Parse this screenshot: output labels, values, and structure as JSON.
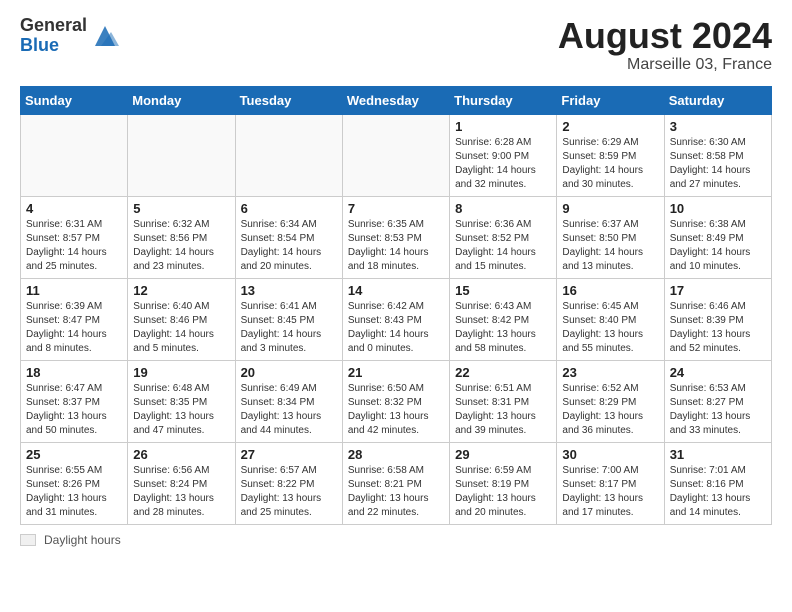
{
  "header": {
    "logo_general": "General",
    "logo_blue": "Blue",
    "month_year": "August 2024",
    "location": "Marseille 03, France"
  },
  "weekdays": [
    "Sunday",
    "Monday",
    "Tuesday",
    "Wednesday",
    "Thursday",
    "Friday",
    "Saturday"
  ],
  "weeks": [
    [
      {
        "day": "",
        "info": ""
      },
      {
        "day": "",
        "info": ""
      },
      {
        "day": "",
        "info": ""
      },
      {
        "day": "",
        "info": ""
      },
      {
        "day": "1",
        "info": "Sunrise: 6:28 AM\nSunset: 9:00 PM\nDaylight: 14 hours\nand 32 minutes."
      },
      {
        "day": "2",
        "info": "Sunrise: 6:29 AM\nSunset: 8:59 PM\nDaylight: 14 hours\nand 30 minutes."
      },
      {
        "day": "3",
        "info": "Sunrise: 6:30 AM\nSunset: 8:58 PM\nDaylight: 14 hours\nand 27 minutes."
      }
    ],
    [
      {
        "day": "4",
        "info": "Sunrise: 6:31 AM\nSunset: 8:57 PM\nDaylight: 14 hours\nand 25 minutes."
      },
      {
        "day": "5",
        "info": "Sunrise: 6:32 AM\nSunset: 8:56 PM\nDaylight: 14 hours\nand 23 minutes."
      },
      {
        "day": "6",
        "info": "Sunrise: 6:34 AM\nSunset: 8:54 PM\nDaylight: 14 hours\nand 20 minutes."
      },
      {
        "day": "7",
        "info": "Sunrise: 6:35 AM\nSunset: 8:53 PM\nDaylight: 14 hours\nand 18 minutes."
      },
      {
        "day": "8",
        "info": "Sunrise: 6:36 AM\nSunset: 8:52 PM\nDaylight: 14 hours\nand 15 minutes."
      },
      {
        "day": "9",
        "info": "Sunrise: 6:37 AM\nSunset: 8:50 PM\nDaylight: 14 hours\nand 13 minutes."
      },
      {
        "day": "10",
        "info": "Sunrise: 6:38 AM\nSunset: 8:49 PM\nDaylight: 14 hours\nand 10 minutes."
      }
    ],
    [
      {
        "day": "11",
        "info": "Sunrise: 6:39 AM\nSunset: 8:47 PM\nDaylight: 14 hours\nand 8 minutes."
      },
      {
        "day": "12",
        "info": "Sunrise: 6:40 AM\nSunset: 8:46 PM\nDaylight: 14 hours\nand 5 minutes."
      },
      {
        "day": "13",
        "info": "Sunrise: 6:41 AM\nSunset: 8:45 PM\nDaylight: 14 hours\nand 3 minutes."
      },
      {
        "day": "14",
        "info": "Sunrise: 6:42 AM\nSunset: 8:43 PM\nDaylight: 14 hours\nand 0 minutes."
      },
      {
        "day": "15",
        "info": "Sunrise: 6:43 AM\nSunset: 8:42 PM\nDaylight: 13 hours\nand 58 minutes."
      },
      {
        "day": "16",
        "info": "Sunrise: 6:45 AM\nSunset: 8:40 PM\nDaylight: 13 hours\nand 55 minutes."
      },
      {
        "day": "17",
        "info": "Sunrise: 6:46 AM\nSunset: 8:39 PM\nDaylight: 13 hours\nand 52 minutes."
      }
    ],
    [
      {
        "day": "18",
        "info": "Sunrise: 6:47 AM\nSunset: 8:37 PM\nDaylight: 13 hours\nand 50 minutes."
      },
      {
        "day": "19",
        "info": "Sunrise: 6:48 AM\nSunset: 8:35 PM\nDaylight: 13 hours\nand 47 minutes."
      },
      {
        "day": "20",
        "info": "Sunrise: 6:49 AM\nSunset: 8:34 PM\nDaylight: 13 hours\nand 44 minutes."
      },
      {
        "day": "21",
        "info": "Sunrise: 6:50 AM\nSunset: 8:32 PM\nDaylight: 13 hours\nand 42 minutes."
      },
      {
        "day": "22",
        "info": "Sunrise: 6:51 AM\nSunset: 8:31 PM\nDaylight: 13 hours\nand 39 minutes."
      },
      {
        "day": "23",
        "info": "Sunrise: 6:52 AM\nSunset: 8:29 PM\nDaylight: 13 hours\nand 36 minutes."
      },
      {
        "day": "24",
        "info": "Sunrise: 6:53 AM\nSunset: 8:27 PM\nDaylight: 13 hours\nand 33 minutes."
      }
    ],
    [
      {
        "day": "25",
        "info": "Sunrise: 6:55 AM\nSunset: 8:26 PM\nDaylight: 13 hours\nand 31 minutes."
      },
      {
        "day": "26",
        "info": "Sunrise: 6:56 AM\nSunset: 8:24 PM\nDaylight: 13 hours\nand 28 minutes."
      },
      {
        "day": "27",
        "info": "Sunrise: 6:57 AM\nSunset: 8:22 PM\nDaylight: 13 hours\nand 25 minutes."
      },
      {
        "day": "28",
        "info": "Sunrise: 6:58 AM\nSunset: 8:21 PM\nDaylight: 13 hours\nand 22 minutes."
      },
      {
        "day": "29",
        "info": "Sunrise: 6:59 AM\nSunset: 8:19 PM\nDaylight: 13 hours\nand 20 minutes."
      },
      {
        "day": "30",
        "info": "Sunrise: 7:00 AM\nSunset: 8:17 PM\nDaylight: 13 hours\nand 17 minutes."
      },
      {
        "day": "31",
        "info": "Sunrise: 7:01 AM\nSunset: 8:16 PM\nDaylight: 13 hours\nand 14 minutes."
      }
    ]
  ],
  "footer": {
    "daylight_label": "Daylight hours"
  }
}
